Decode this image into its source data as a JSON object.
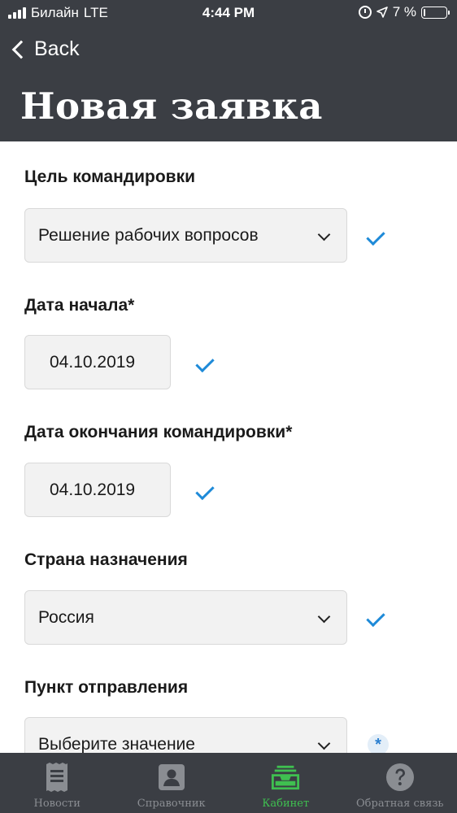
{
  "status_bar": {
    "carrier": "Билайн",
    "network": "LTE",
    "time": "4:44 PM",
    "battery": "7 %",
    "battery_level": 0.07
  },
  "header": {
    "back_label": "Back",
    "title": "Новая заявка"
  },
  "form": {
    "purpose": {
      "label": "Цель командировки",
      "value": "Решение рабочих вопросов"
    },
    "start_date": {
      "label": "Дата начала*",
      "value": "04.10.2019"
    },
    "end_date": {
      "label": "Дата окончания командировки*",
      "value": "04.10.2019"
    },
    "country": {
      "label": "Страна назначения",
      "value": "Россия"
    },
    "departure": {
      "label": "Пункт отправления",
      "placeholder": "Выберите значение",
      "required_mark": "*"
    }
  },
  "tabs": [
    {
      "label": "Новости",
      "icon": "newspaper-icon"
    },
    {
      "label": "Справочник",
      "icon": "contact-book-icon"
    },
    {
      "label": "Кабинет",
      "icon": "inbox-tray-icon",
      "active": true
    },
    {
      "label": "Обратная связь",
      "icon": "question-icon"
    }
  ],
  "colors": {
    "header_bg": "#3b3e44",
    "check": "#1e8ad8",
    "active_tab": "#3fc050",
    "inactive_tab": "#8a8d92"
  }
}
